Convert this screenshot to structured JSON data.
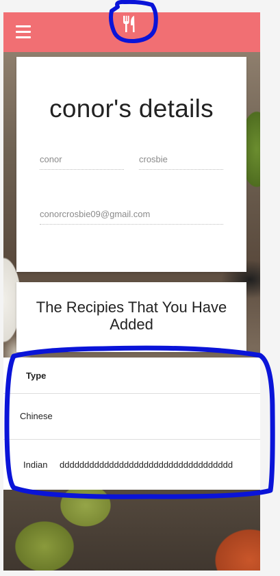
{
  "header": {
    "menu_icon": "hamburger-menu-icon",
    "logo_icon": "fork-and-knife-icon",
    "bg_color": "#f16f73"
  },
  "details": {
    "title": "conor's details",
    "first_name": "conor",
    "last_name": "crosbie",
    "email": "conorcrosbie09@gmail.com"
  },
  "recipes": {
    "title": "The Recipies That You Have Added",
    "columns": [
      "Type"
    ],
    "rows": [
      {
        "type": "Chinese",
        "description": ""
      },
      {
        "type": "Indian",
        "description": "ddddddddddddddddddddddddddddddddddd"
      }
    ]
  },
  "annotation_color": "#0a14d8"
}
